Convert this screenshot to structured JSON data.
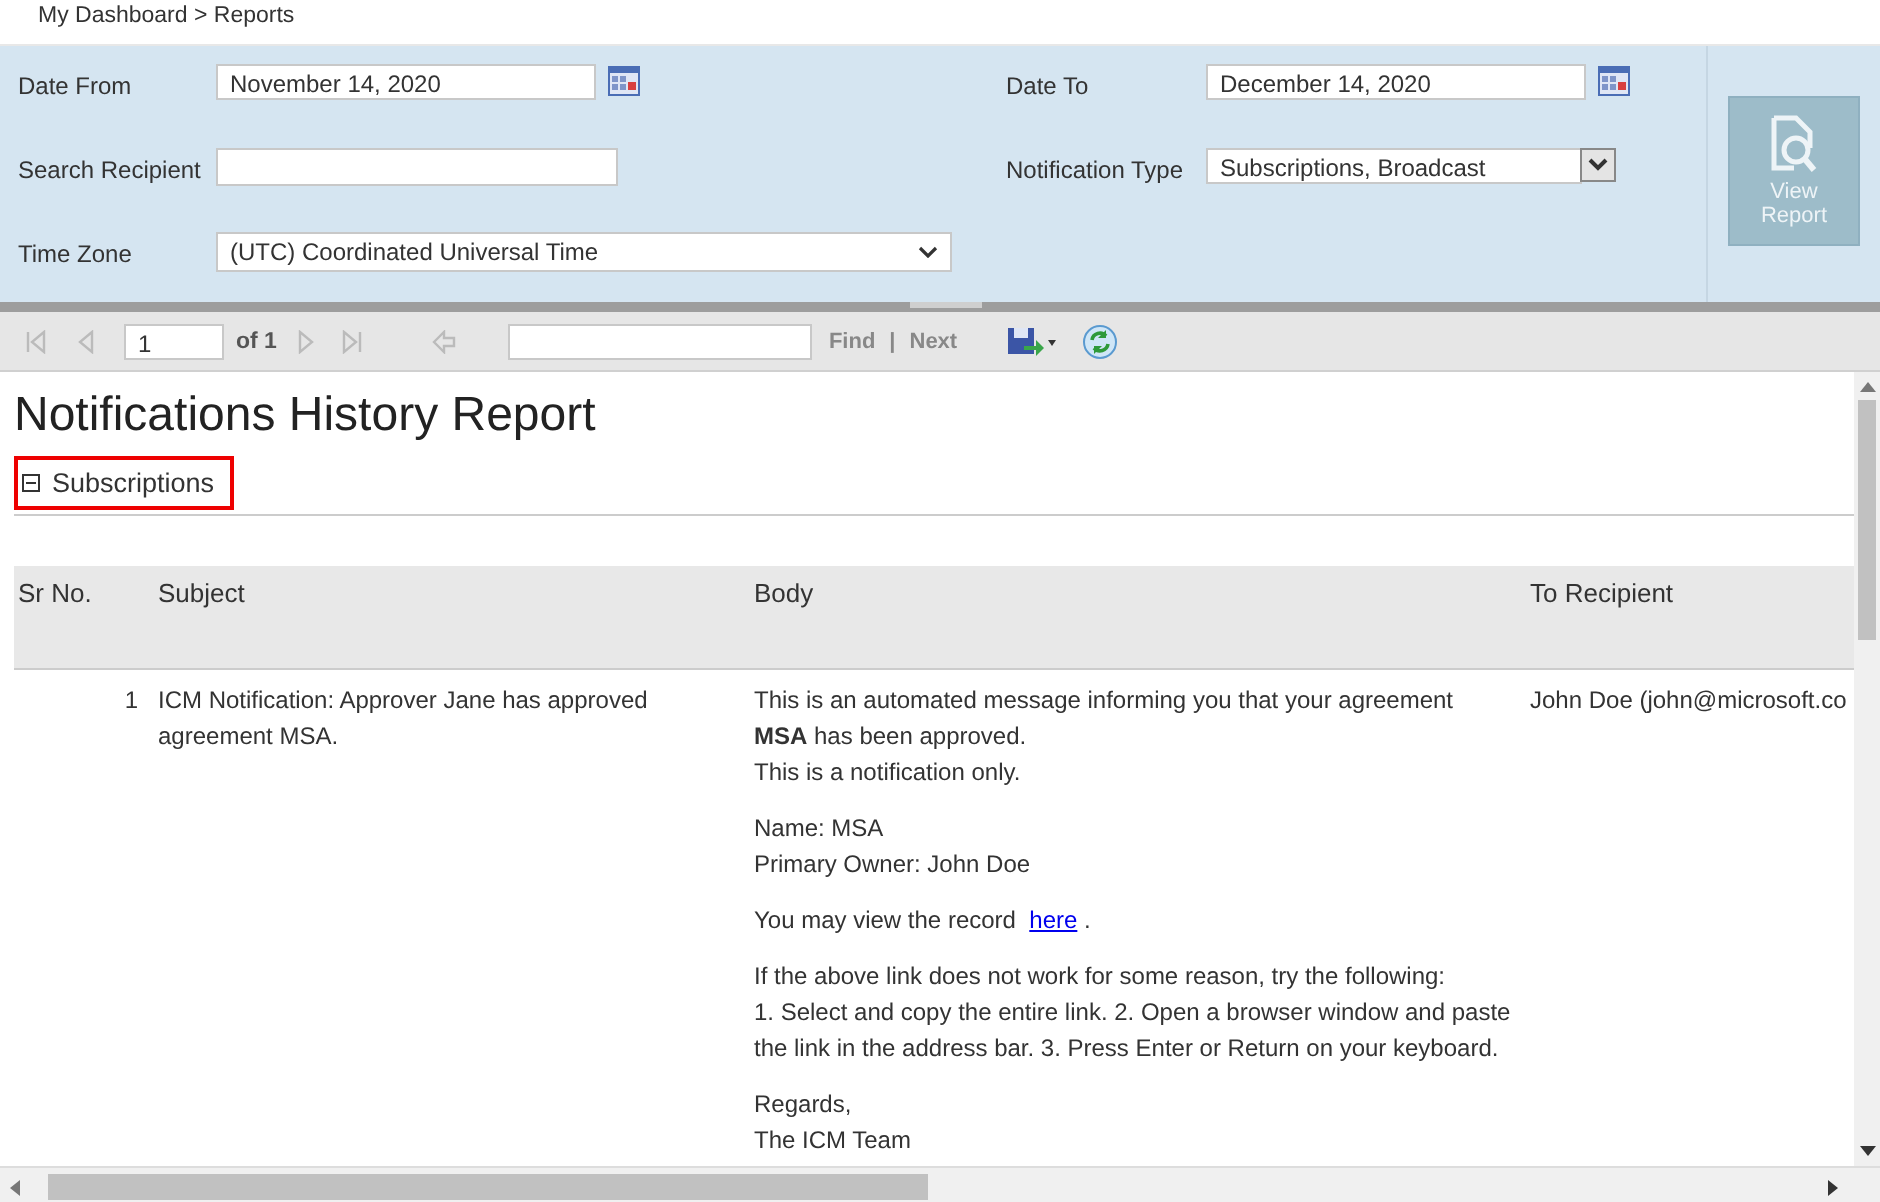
{
  "breadcrumb": "My Dashboard > Reports",
  "filters": {
    "date_from": {
      "label": "Date From",
      "value": "November 14, 2020"
    },
    "date_to": {
      "label": "Date To",
      "value": "December 14, 2020"
    },
    "search_recipient": {
      "label": "Search Recipient"
    },
    "notification_type": {
      "label": "Notification Type",
      "value": "Subscriptions, Broadcast"
    },
    "time_zone": {
      "label": "Time Zone",
      "value": "(UTC) Coordinated Universal Time"
    }
  },
  "view_report_button": {
    "label": "View Report",
    "disabled": true
  },
  "toolbar": {
    "page": "1",
    "of": "of 1",
    "find": "Find",
    "separator": "|",
    "next": "Next"
  },
  "report": {
    "title": "Notifications History Report",
    "section": {
      "label": "Subscriptions",
      "expanded": true,
      "highlighted": true
    },
    "columns": [
      "Sr No.",
      "Subject",
      "Body",
      "To Recipient"
    ],
    "rows": [
      {
        "sr_no": "1",
        "subject": "ICM Notification: Approver Jane has approved agreement MSA.",
        "recipient": "John Doe (john@microsoft.co",
        "body": [
          {
            "kind": "lines",
            "lines": [
              "This is an automated message informing you that your agreement",
              "**MSA** has been approved.",
              "This is a notification only."
            ]
          },
          {
            "kind": "lines",
            "lines": [
              "Name: MSA",
              "Primary Owner: John Doe"
            ]
          },
          {
            "kind": "link",
            "text": "You may view the record",
            "link": "here",
            "after": "."
          },
          {
            "kind": "lines",
            "lines": [
              "If the above link does not work for some reason, try the following:",
              "1. Select and copy the entire link. 2. Open a browser window and paste",
              "the link in the address bar. 3. Press Enter or Return on your keyboard."
            ]
          },
          {
            "kind": "lines",
            "lines": [
              "Regards,",
              "The ICM Team"
            ]
          }
        ]
      }
    ]
  }
}
